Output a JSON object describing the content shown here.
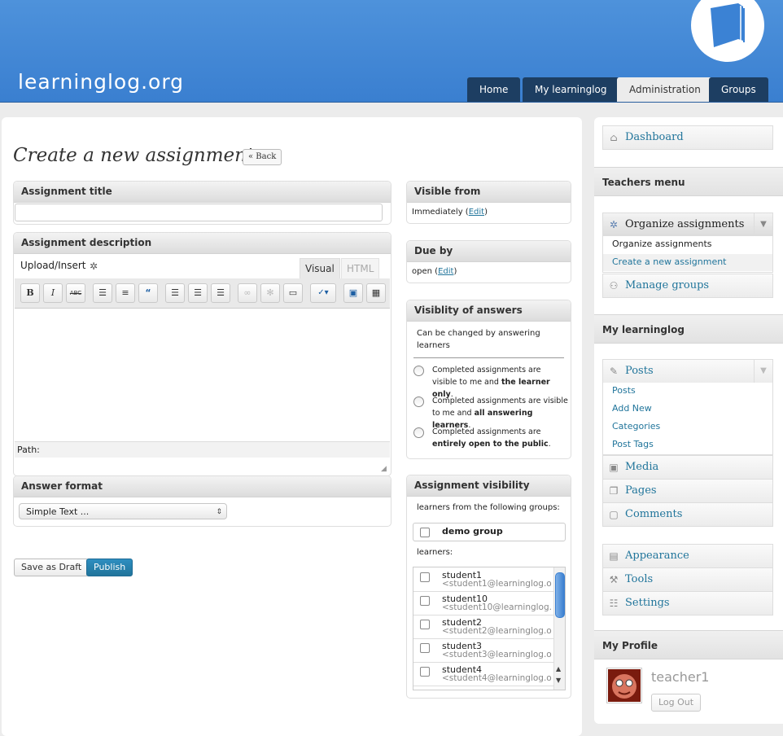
{
  "header": {
    "logo": "learninglog.org",
    "nav": [
      "Home",
      "My learninglog",
      "Administration",
      "Groups"
    ]
  },
  "page": {
    "title": "Create a new assignment",
    "back": "« Back"
  },
  "assignment_title": {
    "label": "Assignment title",
    "value": ""
  },
  "assignment_description": {
    "label": "Assignment description",
    "upload": "Upload/Insert",
    "tab_visual": "Visual",
    "tab_html": "HTML",
    "path_label": "Path:",
    "toolbar": [
      "B",
      "I",
      "ABC",
      "bullist",
      "numlist",
      "blockquote",
      "align-left",
      "align-center",
      "align-right",
      "link",
      "unlink",
      "more",
      "spellcheck",
      "fullscreen",
      "kitchensink"
    ]
  },
  "answer_format": {
    "label": "Answer format",
    "selected": "Simple Text ..."
  },
  "buttons": {
    "save_draft": "Save as Draft",
    "publish": "Publish"
  },
  "visible_from": {
    "label": "Visible from",
    "value": "Immediately",
    "edit": "Edit"
  },
  "due_by": {
    "label": "Due by",
    "value": "open",
    "edit": "Edit"
  },
  "visibility_of_answers": {
    "label": "Visiblity of answers",
    "note": "Can be changed by answering learners",
    "options": [
      {
        "pre": "Completed assignments are visible to me and",
        "bold": "the learner only",
        "post": "."
      },
      {
        "pre": "Completed assignments are visible to me and",
        "bold": "all answering learners",
        "post": "."
      },
      {
        "pre": "Completed assignments are",
        "bold": "entirely open to the public",
        "post": "."
      }
    ]
  },
  "assignment_visibility": {
    "label": "Assignment visibility",
    "groups_label": "learners from the following groups:",
    "group": "demo group",
    "learners_label": "learners:",
    "learners": [
      {
        "name": "student1",
        "email": "<student1@learninglog.o"
      },
      {
        "name": "student10",
        "email": "<student10@learninglog."
      },
      {
        "name": "student2",
        "email": "<student2@learninglog.o"
      },
      {
        "name": "student3",
        "email": "<student3@learninglog.o"
      },
      {
        "name": "student4",
        "email": "<student4@learninglog.o"
      }
    ]
  },
  "sidebar": {
    "dashboard": "Dashboard",
    "teachers_menu": "Teachers menu",
    "organize": "Organize assignments",
    "organize_sub": [
      "Organize assignments",
      "Create a new assignment"
    ],
    "manage_groups": "Manage groups",
    "my_learninglog": "My learninglog",
    "posts": "Posts",
    "posts_sub": [
      "Posts",
      "Add New",
      "Categories",
      "Post Tags"
    ],
    "media": "Media",
    "pages": "Pages",
    "comments": "Comments",
    "appearance": "Appearance",
    "tools": "Tools",
    "settings": "Settings",
    "my_profile": "My Profile",
    "username": "teacher1",
    "logout": "Log Out"
  }
}
